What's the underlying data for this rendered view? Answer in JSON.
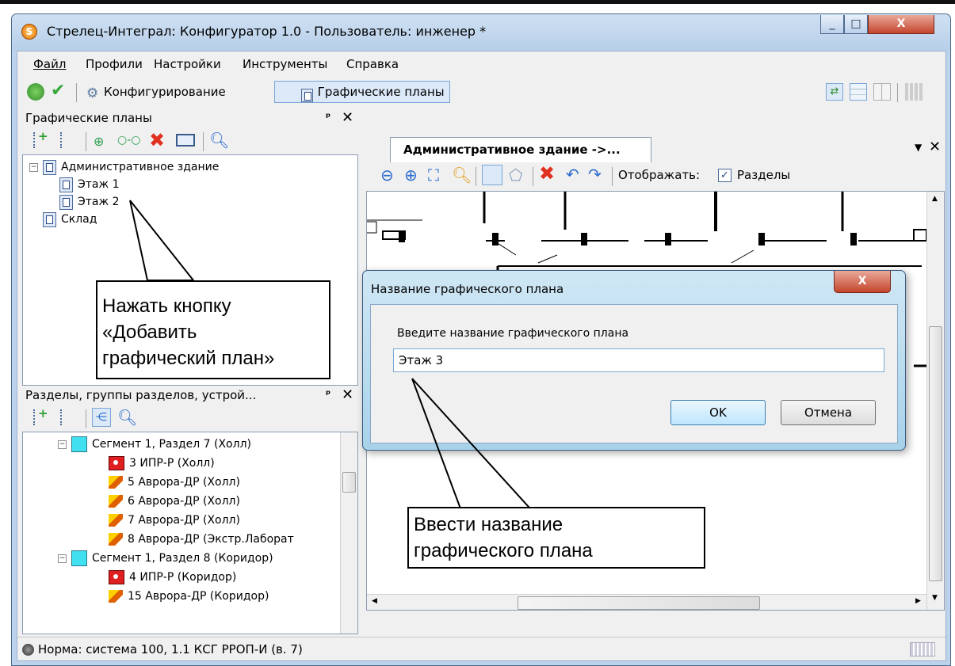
{
  "window": {
    "title": "Стрелец-Интеграл: Конфигуратор 1.0 - Пользователь: инженер *",
    "buttons": {
      "minimize": "_",
      "maximize": "□",
      "close": "X"
    }
  },
  "menu": [
    "Файл",
    "Профили",
    "Настройки",
    "Инструменты",
    "Справка"
  ],
  "toolbar": {
    "configure_label": "Конфигурирование",
    "graphic_plans_label": "Графические планы"
  },
  "plans_panel": {
    "title": "Графические планы",
    "tree": [
      {
        "label": "Административное здание",
        "level": 0,
        "expanded": true
      },
      {
        "label": "Этаж 1",
        "level": 1
      },
      {
        "label": "Этаж 2",
        "level": 1
      },
      {
        "label": "Склад",
        "level": 0
      }
    ]
  },
  "sections_panel": {
    "title": "Разделы, группы разделов, устрой...",
    "tree": [
      {
        "label": "Сегмент 1, Раздел 7 (Холл)",
        "type": "section"
      },
      {
        "label": "3 ИПР-Р (Холл)",
        "type": "ipr"
      },
      {
        "label": "5 Аврора-ДР (Холл)",
        "type": "avrora"
      },
      {
        "label": "6 Аврора-ДР (Холл)",
        "type": "avrora"
      },
      {
        "label": "7 Аврора-ДР (Холл)",
        "type": "avrora"
      },
      {
        "label": "8 Аврора-ДР (Экстр.Лаборат",
        "type": "avrora"
      },
      {
        "label": "Сегмент 1, Раздел 8 (Коридор)",
        "type": "section"
      },
      {
        "label": "4 ИПР-Р (Коридор)",
        "type": "ipr"
      },
      {
        "label": "15 Аврора-ДР (Коридор)",
        "type": "avrora"
      }
    ]
  },
  "document": {
    "tab_label": "Административное здание ->...",
    "show_label": "Отображать:",
    "sections_checkbox_label": "Разделы",
    "sections_checked": true
  },
  "dialog": {
    "title": "Название графического плана",
    "prompt": "Введите название графического плана",
    "input_value": "Этаж 3",
    "ok_label": "OK",
    "cancel_label": "Отмена",
    "close_label": "X"
  },
  "callouts": {
    "add_plan": [
      "Нажать кнопку",
      "«Добавить",
      "графический план»"
    ],
    "enter_name": [
      "Ввести название",
      "графического плана"
    ]
  },
  "status": {
    "text": "Норма:  система 100, 1.1 КСГ РРОП-И (в. 7)"
  },
  "colors": {
    "title_bar": "#bdd3ec",
    "section_icon": "#40e0f0",
    "ipr_icon": "#e02020",
    "active_button": "#dce9f8"
  }
}
